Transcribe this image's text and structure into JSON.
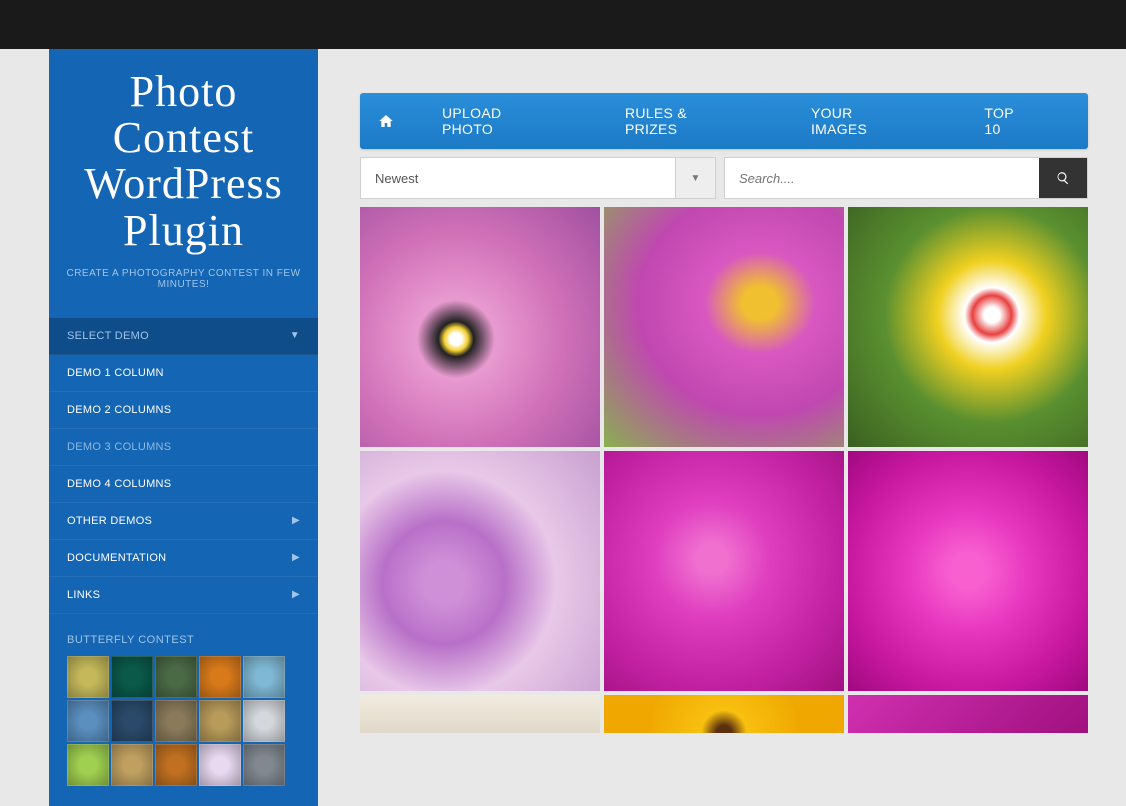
{
  "brand": {
    "title_line1": "Photo Contest",
    "title_line2": "WordPress Plugin",
    "tagline": "CREATE A PHOTOGRAPHY CONTEST IN FEW MINUTES!"
  },
  "sidebar": {
    "select_header": "SELECT DEMO",
    "items": [
      {
        "label": "DEMO 1 COLUMN",
        "active": false,
        "submenu": false
      },
      {
        "label": "DEMO 2 COLUMNS",
        "active": false,
        "submenu": false
      },
      {
        "label": "DEMO 3 COLUMNS",
        "active": true,
        "submenu": false
      },
      {
        "label": "DEMO 4 COLUMNS",
        "active": false,
        "submenu": false
      },
      {
        "label": "OTHER DEMOS",
        "active": false,
        "submenu": true
      },
      {
        "label": "DOCUMENTATION",
        "active": false,
        "submenu": true
      },
      {
        "label": "LINKS",
        "active": false,
        "submenu": true
      }
    ],
    "widget_title": "BUTTERFLY CONTEST",
    "thumb_colors": [
      "#c4b85a",
      "#0a5a4a",
      "#4a6a45",
      "#d97a1a",
      "#7fb8d4",
      "#5a8fc0",
      "#2a4a6a",
      "#8a7a5a",
      "#b89a5a",
      "#d4d8dc",
      "#a0d050",
      "#c0a060",
      "#c07020",
      "#e8d8f0",
      "#808890"
    ]
  },
  "nav": {
    "items": [
      "UPLOAD PHOTO",
      "RULES & PRIZES",
      "YOUR IMAGES",
      "TOP 10"
    ]
  },
  "sort": {
    "selected": "Newest"
  },
  "search": {
    "placeholder": "Search...."
  },
  "gallery": {
    "row1": [
      "img-cosmos",
      "img-daisy-drops",
      "img-tulips"
    ],
    "row2": [
      "img-lavender",
      "img-petal-drops",
      "img-rose"
    ],
    "row3": [
      "img-white",
      "img-sunflower",
      "img-magenta"
    ]
  },
  "gallery_gradients": {
    "img-cosmos": "radial-gradient(circle at 40% 55%, #fff 3%, #f5d030 6%, #222 9%, #e89ad0 20%, #d070b8 55%, #a050a0 100%)",
    "img-daisy-drops": "radial-gradient(ellipse at 65% 40%, #f0c030 8%, #d858c0 25%, #c048b0 55%, #8ab050 100%)",
    "img-tulips": "radial-gradient(circle at 60% 45%, #fff 4%, #e84040 10%, #fff 14%, #f0d020 28%, #5a9030 55%, #3a6020 100%)",
    "img-lavender": "radial-gradient(circle at 35% 55%, #d090d8 10%, #b870c8 30%, #e8c8e8 55%, #c8a0d0 100%)",
    "img-petal-drops": "radial-gradient(circle at 45% 45%, #f070d0 8%, #e040c0 30%, #c020a0 70%, #a01080 100%)",
    "img-rose": "radial-gradient(circle at 50% 50%, #f860d0 10%, #e838c0 35%, #c818a0 70%, #a00880 100%)",
    "img-white": "linear-gradient(#f0ece0, #e0d8c8)",
    "img-sunflower": "radial-gradient(circle at 50% 100%, #5a3010 6%, #f8c010 18%, #f0a800 60%)",
    "img-magenta": "linear-gradient(135deg, #d030b0, #a01080)"
  }
}
